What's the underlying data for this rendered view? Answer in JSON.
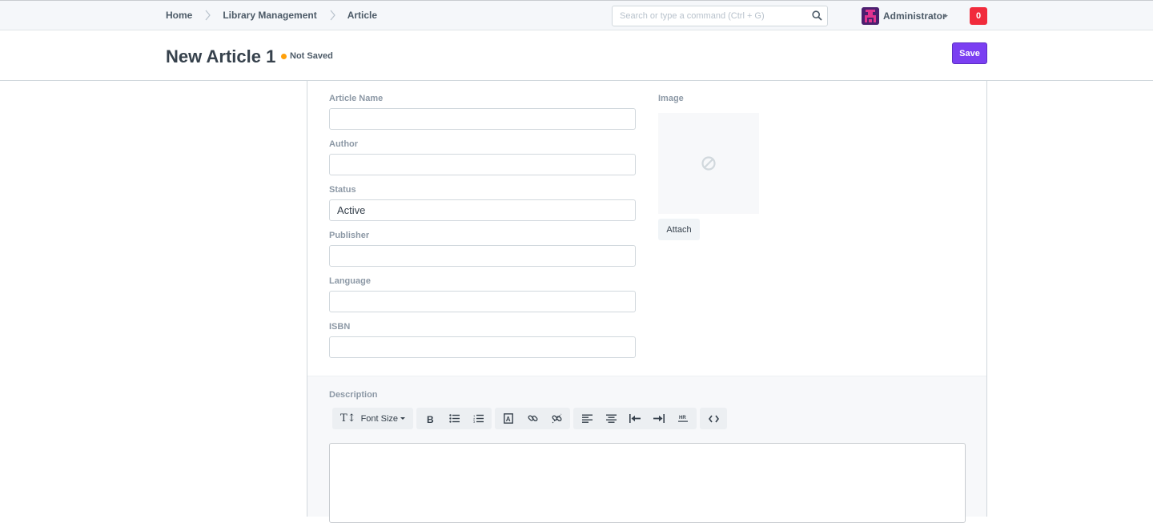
{
  "navbar": {
    "breadcrumbs": [
      "Home",
      "Library Management",
      "Article"
    ],
    "search_placeholder": "Search or type a command (Ctrl + G)",
    "user_name": "Administrator",
    "notification_count": "0"
  },
  "page_head": {
    "title": "New Article 1",
    "indicator": "Not Saved",
    "indicator_color": "#ffa00a",
    "save_label": "Save",
    "primary_color": "#7b3ff2"
  },
  "form": {
    "fields": [
      {
        "label": "Article Name",
        "value": ""
      },
      {
        "label": "Author",
        "value": ""
      },
      {
        "label": "Status",
        "value": "Active"
      },
      {
        "label": "Publisher",
        "value": ""
      },
      {
        "label": "Language",
        "value": ""
      },
      {
        "label": "ISBN",
        "value": ""
      }
    ],
    "image_label": "Image",
    "attach_label": "Attach",
    "description_label": "Description"
  },
  "editor_toolbar": {
    "font_size_label": "Font Size",
    "groups": [
      [
        "font-size"
      ],
      [
        "bold",
        "bullet-list",
        "numbered-list"
      ],
      [
        "image",
        "link",
        "unlink"
      ],
      [
        "align-left",
        "align-center",
        "outdent",
        "indent",
        "horizontal-rule"
      ],
      [
        "code-view"
      ]
    ]
  }
}
